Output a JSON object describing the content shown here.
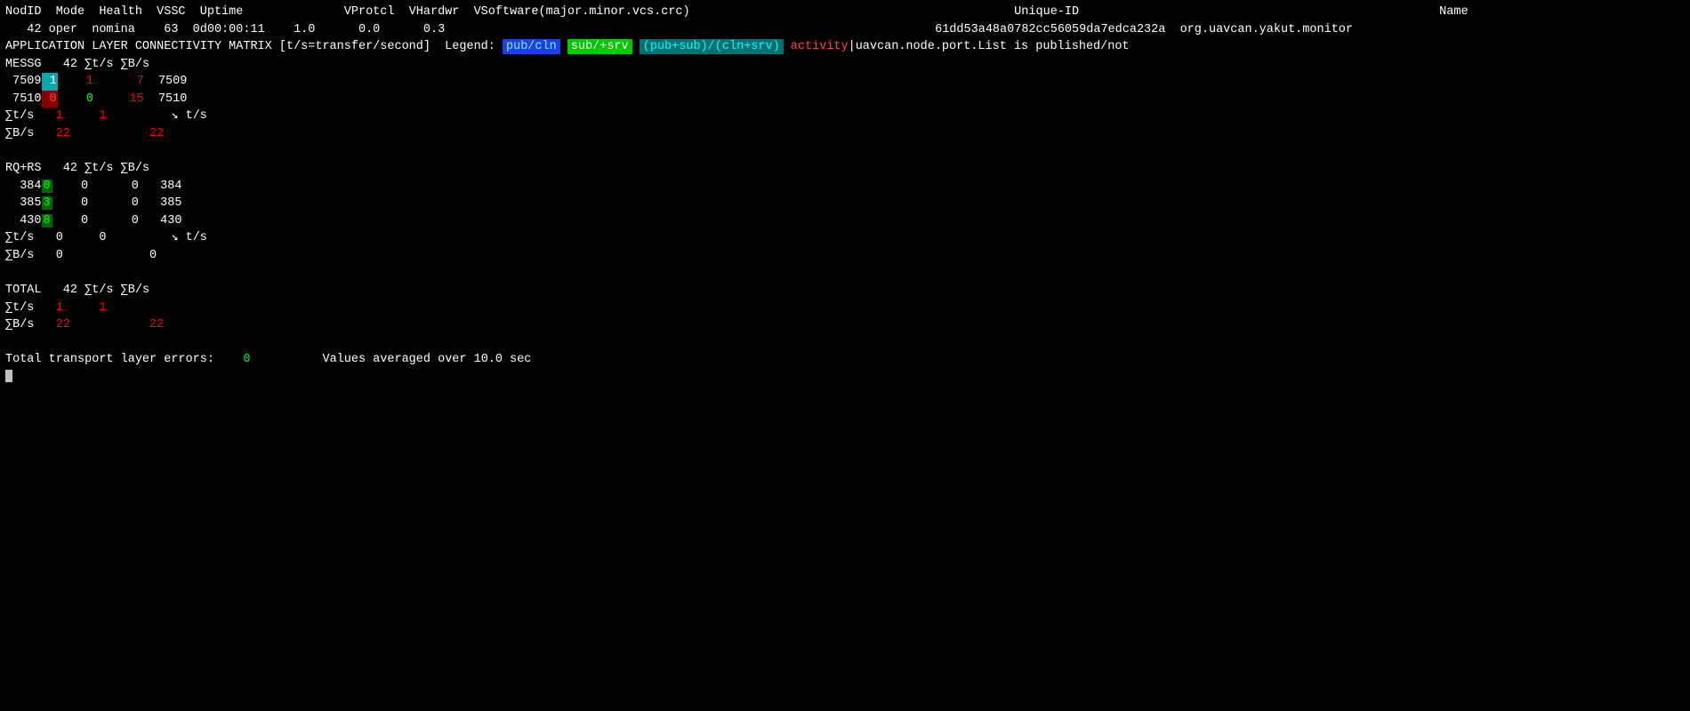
{
  "header": {
    "columns": "NodID  Mode  Health  VSSC  Uptime          VProtcl  VHardwr  VSoftware(major.minor.vcs.crc)                                       Unique-ID                                     Name",
    "node_row": {
      "nodid": "42",
      "mode": "oper",
      "health": "nomina",
      "vssc": "63",
      "uptime": "0d00:00:11",
      "vprotcl": "1.0",
      "vhardwr": "0.0",
      "vsoftware": "0.3",
      "unique_id": "61dd53a48a0782cc56059da7edca232a",
      "name": "org.uavcan.yakut.monitor"
    }
  },
  "app_layer": {
    "title": "APPLICATION LAYER CONNECTIVITY MATRIX",
    "subtitle": "[t/s=transfer/second]",
    "legend_label": "Legend:",
    "legend_items": [
      {
        "text": "pub/cln",
        "style": "blue"
      },
      {
        "text": "sub/+srv",
        "style": "green"
      },
      {
        "text": "(pub+sub)/(cln+srv)",
        "style": "teal"
      },
      {
        "text": "activity",
        "style": "red"
      }
    ],
    "legend_suffix": "uavcan.node.port.List is published/not"
  },
  "messg_section": {
    "label": "MESSG",
    "node_id": "42",
    "sum_ts_label": "∑t/s",
    "sum_bs_label": "∑B/s",
    "rows": [
      {
        "port": "7509",
        "badge": "1",
        "badge_style": "cyan",
        "col2": "1",
        "col3": "7",
        "col4": "7509"
      },
      {
        "port": "7510",
        "badge": "0",
        "badge_style": "red",
        "col2": "0",
        "col3": "15",
        "col4": "7510"
      }
    ],
    "sum_ts": {
      "label": "∑t/s",
      "val1": "1",
      "val2": "1",
      "arrow": "↘ t/s"
    },
    "sum_bs": {
      "label": "∑B/s",
      "val1": "22",
      "val2": "",
      "val3": "22"
    }
  },
  "rqrs_section": {
    "label": "RQ+RS",
    "node_id": "42",
    "sum_ts_label": "∑t/s",
    "sum_bs_label": "∑B/s",
    "rows": [
      {
        "port": "384",
        "badge": "0",
        "badge_style": "green",
        "col2": "0",
        "col3": "0",
        "col4": "384"
      },
      {
        "port": "385",
        "badge": "3",
        "badge_style": "green",
        "col2": "0",
        "col3": "0",
        "col4": "385"
      },
      {
        "port": "430",
        "badge": "8",
        "badge_style": "green",
        "col2": "0",
        "col3": "0",
        "col4": "430"
      }
    ],
    "sum_ts": {
      "label": "∑t/s",
      "val1": "0",
      "val2": "0",
      "arrow": "↘ t/s"
    },
    "sum_bs": {
      "label": "∑B/s",
      "val1": "0",
      "val2": "",
      "val3": "0"
    }
  },
  "total_section": {
    "label": "TOTAL",
    "node_id": "42",
    "sum_ts_label": "∑t/s",
    "sum_bs_label": "∑B/s",
    "sum_ts": {
      "label": "∑t/s",
      "val1": "1",
      "val2": "1"
    },
    "sum_bs": {
      "label": "∑B/s",
      "val1": "22",
      "val2": "",
      "val3": "22"
    }
  },
  "footer": {
    "errors_label": "Total transport layer errors:",
    "errors_value": "0",
    "avg_label": "Values averaged over",
    "avg_value": "10.0 sec"
  },
  "cursor": "▌"
}
